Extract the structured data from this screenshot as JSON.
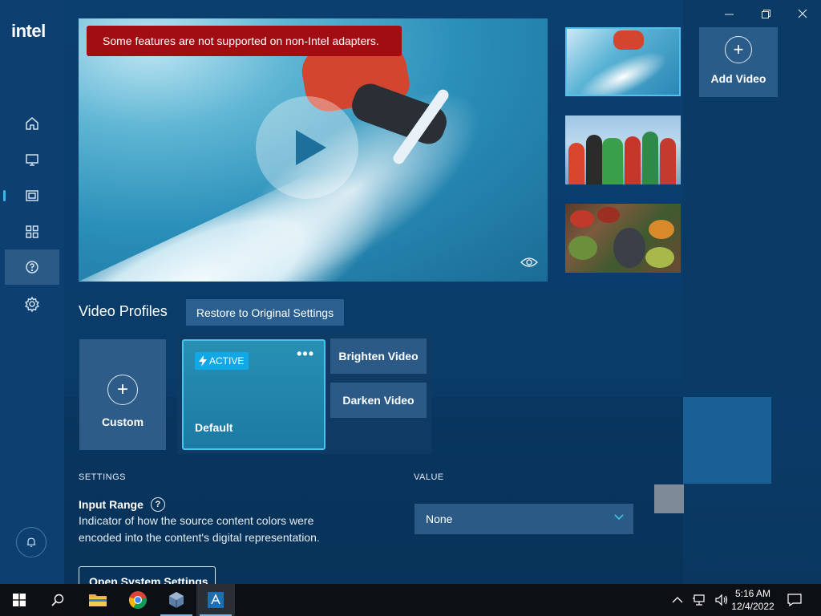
{
  "app": {
    "logo": "intel",
    "banner": "Some features are not supported on non-Intel adapters."
  },
  "sidebar": {
    "items": [
      {
        "name": "home-icon"
      },
      {
        "name": "display-icon"
      },
      {
        "name": "video-icon",
        "active": true
      },
      {
        "name": "apps-icon"
      },
      {
        "name": "help-icon"
      },
      {
        "name": "settings-icon"
      }
    ],
    "bell": "bell-icon"
  },
  "thumbnails": {
    "add_video_label": "Add Video"
  },
  "profiles": {
    "title": "Video Profiles",
    "restore_label": "Restore to Original Settings",
    "custom_label": "Custom",
    "active_badge": "ACTIVE",
    "more_label": "•••",
    "default_label": "Default",
    "brighten_label": "Brighten Video",
    "darken_label": "Darken Video"
  },
  "settings": {
    "settings_col": "SETTINGS",
    "value_col": "VALUE",
    "input_range_label": "Input Range",
    "help_glyph": "?",
    "input_range_desc": "Indicator of how the source content colors were encoded into the content's digital representation.",
    "input_range_value": "None",
    "open_system_settings": "Open System Settings"
  },
  "taskbar": {
    "time": "5:16 AM",
    "date": "12/4/2022"
  },
  "colors": {
    "accent": "#46c4ea",
    "banner": "#a10d12",
    "background": "#0b3f6e"
  }
}
